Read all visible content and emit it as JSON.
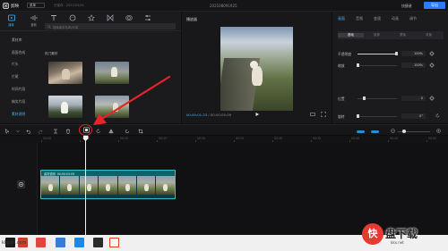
{
  "topbar": {
    "app_name": "剪映",
    "menu_label": "菜单",
    "draft_status": "已保存 · 2022/04/01",
    "project_title": "202108091925",
    "right_items": [
      "快捷键",
      "导出"
    ]
  },
  "toolbar_tabs": [
    {
      "label": "媒体",
      "icon": "media-icon"
    },
    {
      "label": "音频",
      "icon": "audio-icon"
    },
    {
      "label": "文本",
      "icon": "text-icon"
    },
    {
      "label": "贴纸",
      "icon": "sticker-icon"
    },
    {
      "label": "特效",
      "icon": "effects-icon"
    },
    {
      "label": "转场",
      "icon": "transition-icon"
    },
    {
      "label": "滤镜",
      "icon": "filter-icon"
    },
    {
      "label": "调节",
      "icon": "adjust-icon"
    }
  ],
  "media_sidebar": [
    "素材库",
    "画面合成",
    "片头",
    "片尾",
    "时间片段",
    "搞笑片段",
    "素材说明"
  ],
  "search": {
    "placeholder": "搜索素材名称/分类"
  },
  "section_label": "热门素材",
  "player": {
    "title": "播放器",
    "current_time": "00:00:01:23",
    "total_time": "00:00:05:09"
  },
  "properties": {
    "tabs": [
      "画面",
      "音频",
      "变速",
      "动画",
      "调节"
    ],
    "subtabs": [
      "基础",
      "抠像",
      "蒙版",
      "背景"
    ],
    "rows": [
      {
        "label": "不透明度",
        "value": "100%"
      },
      {
        "label": "缩放",
        "value": "100%"
      },
      {
        "label": "位置",
        "value": "0"
      },
      {
        "label": "旋转",
        "value": "0°"
      }
    ]
  },
  "timeline": {
    "tooltip": "定格",
    "ruler_labels": [
      "00:00",
      "00:05",
      "00:10",
      "00:15",
      "00:20",
      "00:25",
      "00:30",
      "00:35",
      "00:40",
      "00:45",
      "00:50"
    ],
    "clip_name": "素材说明",
    "clip_duration": "00:00:05:09"
  },
  "colors": {
    "accent": "#3fb7ff",
    "clip_border": "#35c2c8",
    "highlight": "#e8232a"
  },
  "watermark": {
    "badge": "快",
    "text": "盘下载",
    "url": "kkx.net"
  },
  "corner_text": "kkpan.com"
}
